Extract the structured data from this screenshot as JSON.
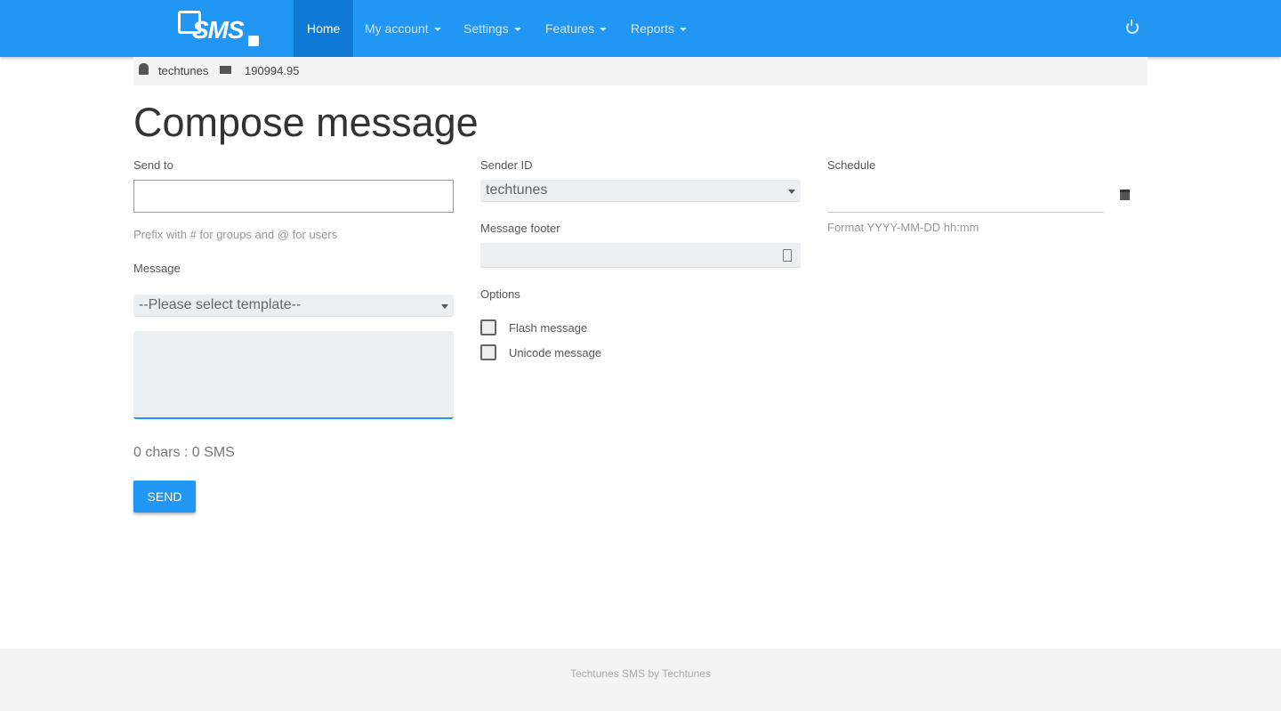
{
  "nav": {
    "logo": "SMS",
    "items": [
      {
        "label": "Home"
      },
      {
        "label": "My account"
      },
      {
        "label": "Settings"
      },
      {
        "label": "Features"
      },
      {
        "label": "Reports"
      }
    ]
  },
  "info": {
    "username": "techtunes",
    "balance": "190994.95"
  },
  "page": {
    "title": "Compose message"
  },
  "form": {
    "send_to_label": "Send to",
    "send_to_value": "",
    "send_to_hint": "Prefix with # for groups and @ for users",
    "message_label": "Message",
    "template_value": "--Please select template--",
    "message_value": "",
    "counter": "0 chars : 0 SMS",
    "send_label": "SEND",
    "sender_label": "Sender ID",
    "sender_value": "techtunes",
    "footer_label": "Message footer",
    "footer_value": "",
    "options_label": "Options",
    "flash_label": "Flash message",
    "unicode_label": "Unicode message",
    "schedule_label": "Schedule",
    "schedule_value": "",
    "schedule_hint": "Format YYYY-MM-DD hh:mm"
  },
  "footer": {
    "text": "Techtunes SMS by Techtunes"
  }
}
